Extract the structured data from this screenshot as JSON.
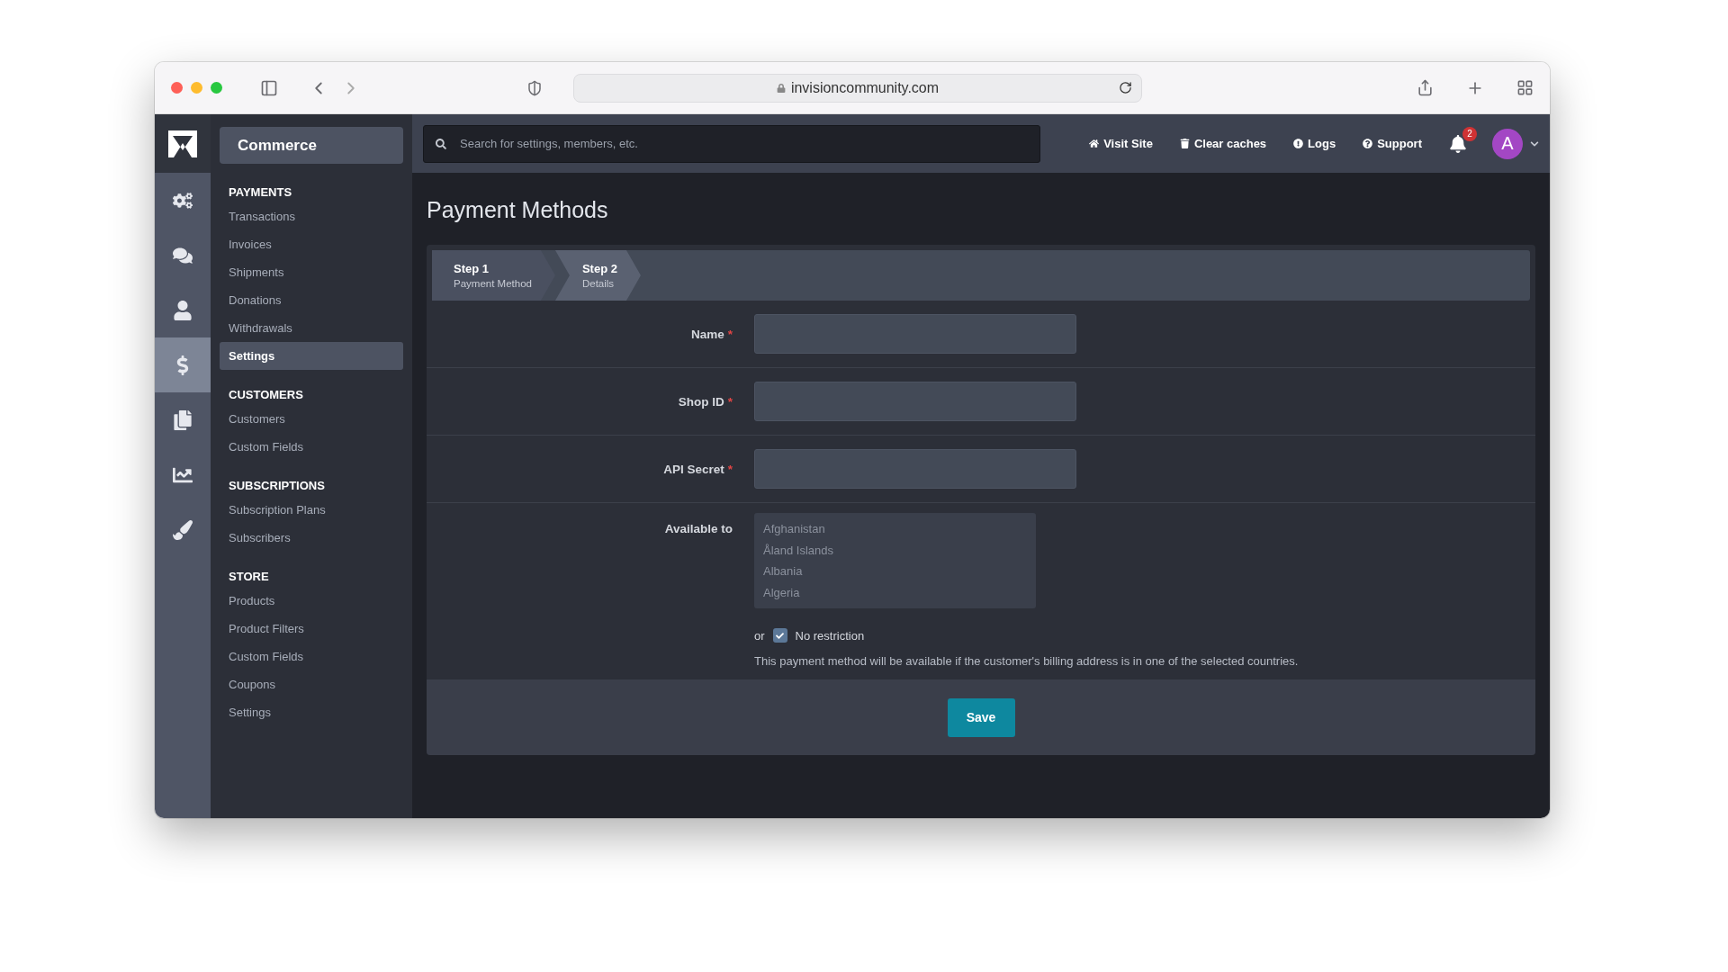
{
  "browser": {
    "url": "invisioncommunity.com"
  },
  "rail": [
    {
      "kind": "gears",
      "selected": false
    },
    {
      "kind": "chat",
      "selected": false
    },
    {
      "kind": "person",
      "selected": false
    },
    {
      "kind": "dollar",
      "selected": true
    },
    {
      "kind": "copy",
      "selected": false
    },
    {
      "kind": "chart",
      "selected": false
    },
    {
      "kind": "brush",
      "selected": false
    }
  ],
  "sidebar": {
    "title": "Commerce",
    "sections": [
      {
        "heading": "PAYMENTS",
        "items": [
          {
            "label": "Transactions",
            "selected": false
          },
          {
            "label": "Invoices",
            "selected": false
          },
          {
            "label": "Shipments",
            "selected": false
          },
          {
            "label": "Donations",
            "selected": false
          },
          {
            "label": "Withdrawals",
            "selected": false
          },
          {
            "label": "Settings",
            "selected": true
          }
        ]
      },
      {
        "heading": "CUSTOMERS",
        "items": [
          {
            "label": "Customers",
            "selected": false
          },
          {
            "label": "Custom Fields",
            "selected": false
          }
        ]
      },
      {
        "heading": "SUBSCRIPTIONS",
        "items": [
          {
            "label": "Subscription Plans",
            "selected": false
          },
          {
            "label": "Subscribers",
            "selected": false
          }
        ]
      },
      {
        "heading": "STORE",
        "items": [
          {
            "label": "Products",
            "selected": false
          },
          {
            "label": "Product Filters",
            "selected": false
          },
          {
            "label": "Custom Fields",
            "selected": false
          },
          {
            "label": "Coupons",
            "selected": false
          },
          {
            "label": "Settings",
            "selected": false
          }
        ]
      }
    ]
  },
  "topbar": {
    "search": {
      "placeholder": "Search for settings, members, etc."
    },
    "links": [
      {
        "kind": "home",
        "label": "Visit Site"
      },
      {
        "kind": "trash",
        "label": "Clear caches"
      },
      {
        "kind": "alert",
        "label": "Logs"
      },
      {
        "kind": "help",
        "label": "Support"
      }
    ],
    "notifications": "2",
    "avatar": "A"
  },
  "page": {
    "title": "Payment Methods",
    "steps": [
      {
        "title": "Step 1",
        "subtitle": "Payment Method",
        "selected": false
      },
      {
        "title": "Step 2",
        "subtitle": "Details",
        "selected": true
      }
    ],
    "required_mark": "*",
    "fields": [
      {
        "label": "Name",
        "required": true
      },
      {
        "label": "Shop ID",
        "required": true
      },
      {
        "label": "API Secret",
        "required": true
      }
    ],
    "available_to": {
      "label": "Available to",
      "options": [
        "Afghanistan",
        "Åland Islands",
        "Albania",
        "Algeria"
      ],
      "or_text": "or",
      "no_restriction": {
        "label": "No restriction",
        "checked": true
      },
      "help": "This payment method will be available if the customer's billing address is in one of the selected countries."
    },
    "save": "Save"
  }
}
